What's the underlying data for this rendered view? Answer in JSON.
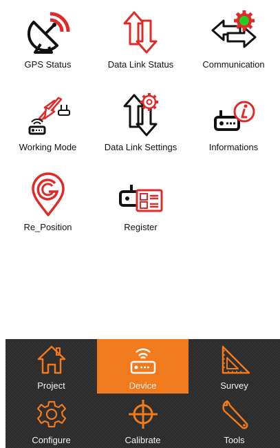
{
  "grid": {
    "items": [
      {
        "label": "GPS Status",
        "icon": "satellite-dish-icon"
      },
      {
        "label": "Data Link Status",
        "icon": "data-link-arrows-icon"
      },
      {
        "label": "Communication",
        "icon": "communication-arrows-icon"
      },
      {
        "label": "Working Mode",
        "icon": "working-mode-icon"
      },
      {
        "label": "Data Link Settings",
        "icon": "data-link-settings-icon"
      },
      {
        "label": "Informations",
        "icon": "device-info-icon"
      },
      {
        "label": "Re_Position",
        "icon": "map-pin-g-icon"
      },
      {
        "label": "Register",
        "icon": "device-register-icon"
      }
    ]
  },
  "bottom_nav": {
    "items": [
      {
        "label": "Project",
        "icon": "home-icon"
      },
      {
        "label": "Device",
        "icon": "device-router-icon",
        "active": true
      },
      {
        "label": "Survey",
        "icon": "set-square-icon"
      },
      {
        "label": "Configure",
        "icon": "gear-icon"
      },
      {
        "label": "Calibrate",
        "icon": "crosshair-icon"
      },
      {
        "label": "Tools",
        "icon": "wrench-icon"
      }
    ]
  },
  "colors": {
    "accent_red": "#e02a2a",
    "accent_orange": "#f07a1c",
    "status_green": "#22cc22",
    "nav_background": "#2b2b2b"
  }
}
